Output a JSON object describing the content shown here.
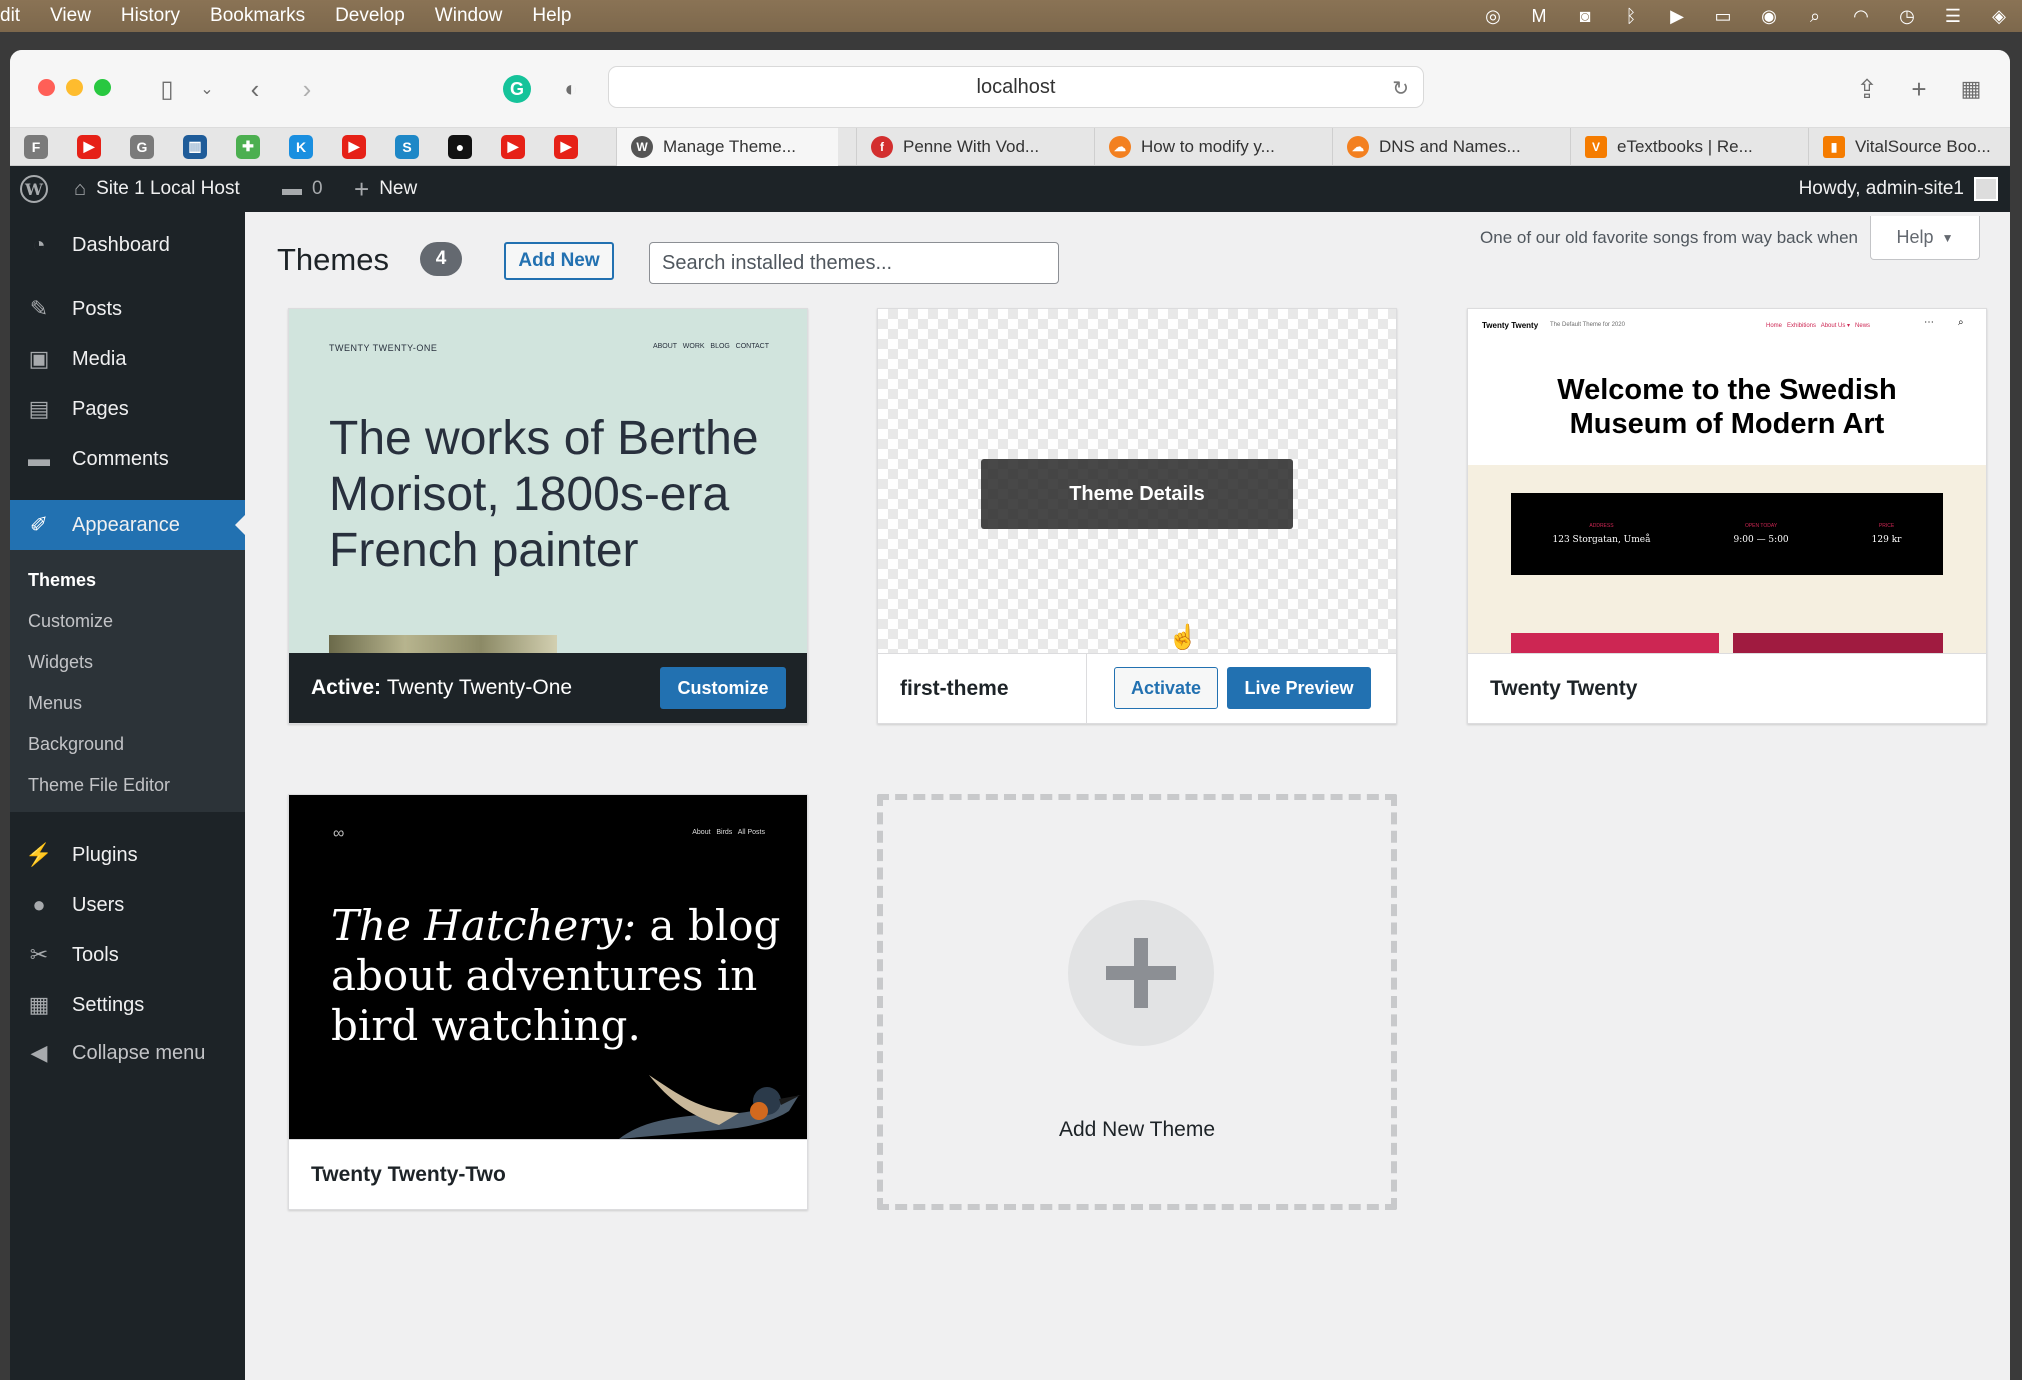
{
  "menubar": {
    "items": [
      "dit",
      "View",
      "History",
      "Bookmarks",
      "Develop",
      "Window",
      "Help"
    ]
  },
  "browser": {
    "url": "localhost",
    "tabs": [
      {
        "label": "Manage Theme...",
        "icon": "wordpress-icon"
      },
      {
        "label": "Penne With Vod...",
        "icon": "food-icon"
      },
      {
        "label": "How to modify y...",
        "icon": "cloud-icon"
      },
      {
        "label": "DNS and Names...",
        "icon": "cloud-icon"
      },
      {
        "label": "eTextbooks | Re...",
        "icon": "v-icon"
      },
      {
        "label": "VitalSource Boo...",
        "icon": "bookmark-icon"
      }
    ],
    "favorites": [
      {
        "letter": "F",
        "color": "#7a7a7a"
      },
      {
        "letter": "▶",
        "color": "#e62117"
      },
      {
        "letter": "G",
        "color": "#7a7a7a"
      },
      {
        "letter": "▥",
        "color": "#1f5c99"
      },
      {
        "letter": "✚",
        "color": "#4caf50"
      },
      {
        "letter": "K",
        "color": "#1a8fe0"
      },
      {
        "letter": "▶",
        "color": "#e62117"
      },
      {
        "letter": "S",
        "color": "#1e88c7"
      },
      {
        "letter": "●",
        "color": "#111111"
      },
      {
        "letter": "▶",
        "color": "#e62117"
      },
      {
        "letter": "▶",
        "color": "#e62117"
      }
    ]
  },
  "adminbar": {
    "site_name": "Site 1 Local Host",
    "comments_count": "0",
    "new_label": "New",
    "howdy": "Howdy, admin-site1"
  },
  "sidebar": {
    "items": [
      {
        "label": "Dashboard",
        "icon": "dashboard-icon",
        "glyph": "◔"
      },
      {
        "label": "Posts",
        "icon": "pin-icon",
        "glyph": "✎"
      },
      {
        "label": "Media",
        "icon": "media-icon",
        "glyph": "▣"
      },
      {
        "label": "Pages",
        "icon": "pages-icon",
        "glyph": "▤"
      },
      {
        "label": "Comments",
        "icon": "comment-icon",
        "glyph": "▬"
      },
      {
        "label": "Appearance",
        "icon": "brush-icon",
        "glyph": "✐"
      },
      {
        "label": "Plugins",
        "icon": "plugin-icon",
        "glyph": "⚡"
      },
      {
        "label": "Users",
        "icon": "user-icon",
        "glyph": "●"
      },
      {
        "label": "Tools",
        "icon": "wrench-icon",
        "glyph": "✂"
      },
      {
        "label": "Settings",
        "icon": "settings-icon",
        "glyph": "▦"
      },
      {
        "label": "Collapse menu",
        "icon": "collapse-icon",
        "glyph": "◀"
      }
    ],
    "submenu": [
      "Themes",
      "Customize",
      "Widgets",
      "Menus",
      "Background",
      "Theme File Editor"
    ]
  },
  "header": {
    "title": "Themes",
    "count": "4",
    "add_new": "Add New",
    "search_placeholder": "Search installed themes...",
    "lyric": "One of our old favorite songs from way back when",
    "help": "Help"
  },
  "themes": {
    "t21": {
      "site_title": "TWENTY TWENTY-ONE",
      "nav": "ABOUT   WORK   BLOG   CONTACT",
      "headline_1": "The works of Berthe",
      "headline_2": "Morisot, 1800s-era",
      "headline_3": "French painter",
      "active_prefix": "Active:",
      "name": "Twenty Twenty-One",
      "customize": "Customize"
    },
    "first": {
      "details": "Theme Details",
      "name": "first-theme",
      "activate": "Activate",
      "live_preview": "Live Preview"
    },
    "t20": {
      "brand": "Twenty Twenty",
      "tagline": "The Default Theme for 2020",
      "nav": "Home   Exhibitions   About Us ▾   News",
      "headline_1": "Welcome to the Swedish",
      "headline_2": "Museum of Modern Art",
      "info": [
        {
          "label": "ADDRESS",
          "value": "123 Storgatan, Umeå"
        },
        {
          "label": "OPEN TODAY",
          "value": "9:00 — 5:00"
        },
        {
          "label": "PRICE",
          "value": "129 kr"
        }
      ],
      "name": "Twenty Twenty"
    },
    "t22": {
      "nav": "About   Birds   All Posts",
      "headline_italic": "The Hatchery:",
      "headline_1": " a blog",
      "headline_2": "about adventures in",
      "headline_3": "bird watching.",
      "name": "Twenty Twenty-Two"
    },
    "add_new_theme": "Add New Theme"
  },
  "colors": {
    "wp_blue": "#2271b1",
    "admin_dark": "#1d2327",
    "t20_accent": "#cd2653"
  }
}
